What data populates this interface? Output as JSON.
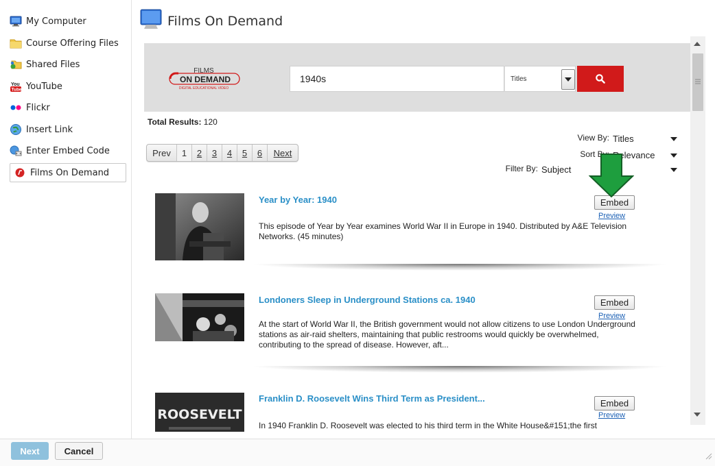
{
  "sidebar": {
    "items": [
      {
        "label": "My Computer",
        "icon": "monitor-icon"
      },
      {
        "label": "Course Offering Files",
        "icon": "folder-icon"
      },
      {
        "label": "Shared Files",
        "icon": "shared-folder-icon"
      },
      {
        "label": "YouTube",
        "icon": "youtube-icon"
      },
      {
        "label": "Flickr",
        "icon": "flickr-icon"
      },
      {
        "label": "Insert Link",
        "icon": "globe-link-icon"
      },
      {
        "label": "Enter Embed Code",
        "icon": "embed-code-icon"
      },
      {
        "label": "Films On Demand",
        "icon": "films-on-demand-icon",
        "selected": true
      }
    ]
  },
  "header": {
    "title": "Films On Demand"
  },
  "logo": {
    "line1": "FILMS",
    "line2": "ON DEMAND",
    "line3": "DIGITAL EDUCATIONAL VIDEO"
  },
  "search": {
    "query": "1940s",
    "scope": "Titles",
    "accent": "#d11a1a"
  },
  "results_info": {
    "label": "Total Results:",
    "count": "120"
  },
  "pager": {
    "prev": "Prev",
    "pages": [
      "1",
      "2",
      "3",
      "4",
      "5",
      "6"
    ],
    "next": "Next",
    "current": "1"
  },
  "controls": {
    "view_by": {
      "label": "View By:",
      "value": "Titles"
    },
    "sort_by": {
      "label": "Sort By:",
      "value": "Relevance"
    },
    "filter_by": {
      "label": "Filter By:",
      "value": "Subject"
    }
  },
  "results": [
    {
      "title": "Year by Year: 1940",
      "description": "This episode of Year by Year examines World War II in Europe in 1940. Distributed by A&E Television Networks. (45 minutes)",
      "embed_label": "Embed",
      "preview_label": "Preview"
    },
    {
      "title": "Londoners Sleep in Underground Stations ca. 1940",
      "description": "At the start of World War II, the British government would not allow citizens to use London Underground stations as air-raid shelters, maintaining that public restrooms would quickly be overwhelmed, contributing to the spread of disease. However, aft...",
      "embed_label": "Embed",
      "preview_label": "Preview"
    },
    {
      "title": "Franklin D. Roosevelt Wins Third Term as President...",
      "description": "In 1940 Franklin D. Roosevelt was elected to his third term in the White House&#151;the first",
      "embed_label": "Embed",
      "preview_label": "Preview",
      "thumb_text": "ROOSEVELT"
    }
  ],
  "footer": {
    "next_label": "Next",
    "cancel_label": "Cancel"
  },
  "colors": {
    "link": "#2a8fc7",
    "arrow": "#1e9e3e",
    "next_button": "#8fc1dd"
  }
}
